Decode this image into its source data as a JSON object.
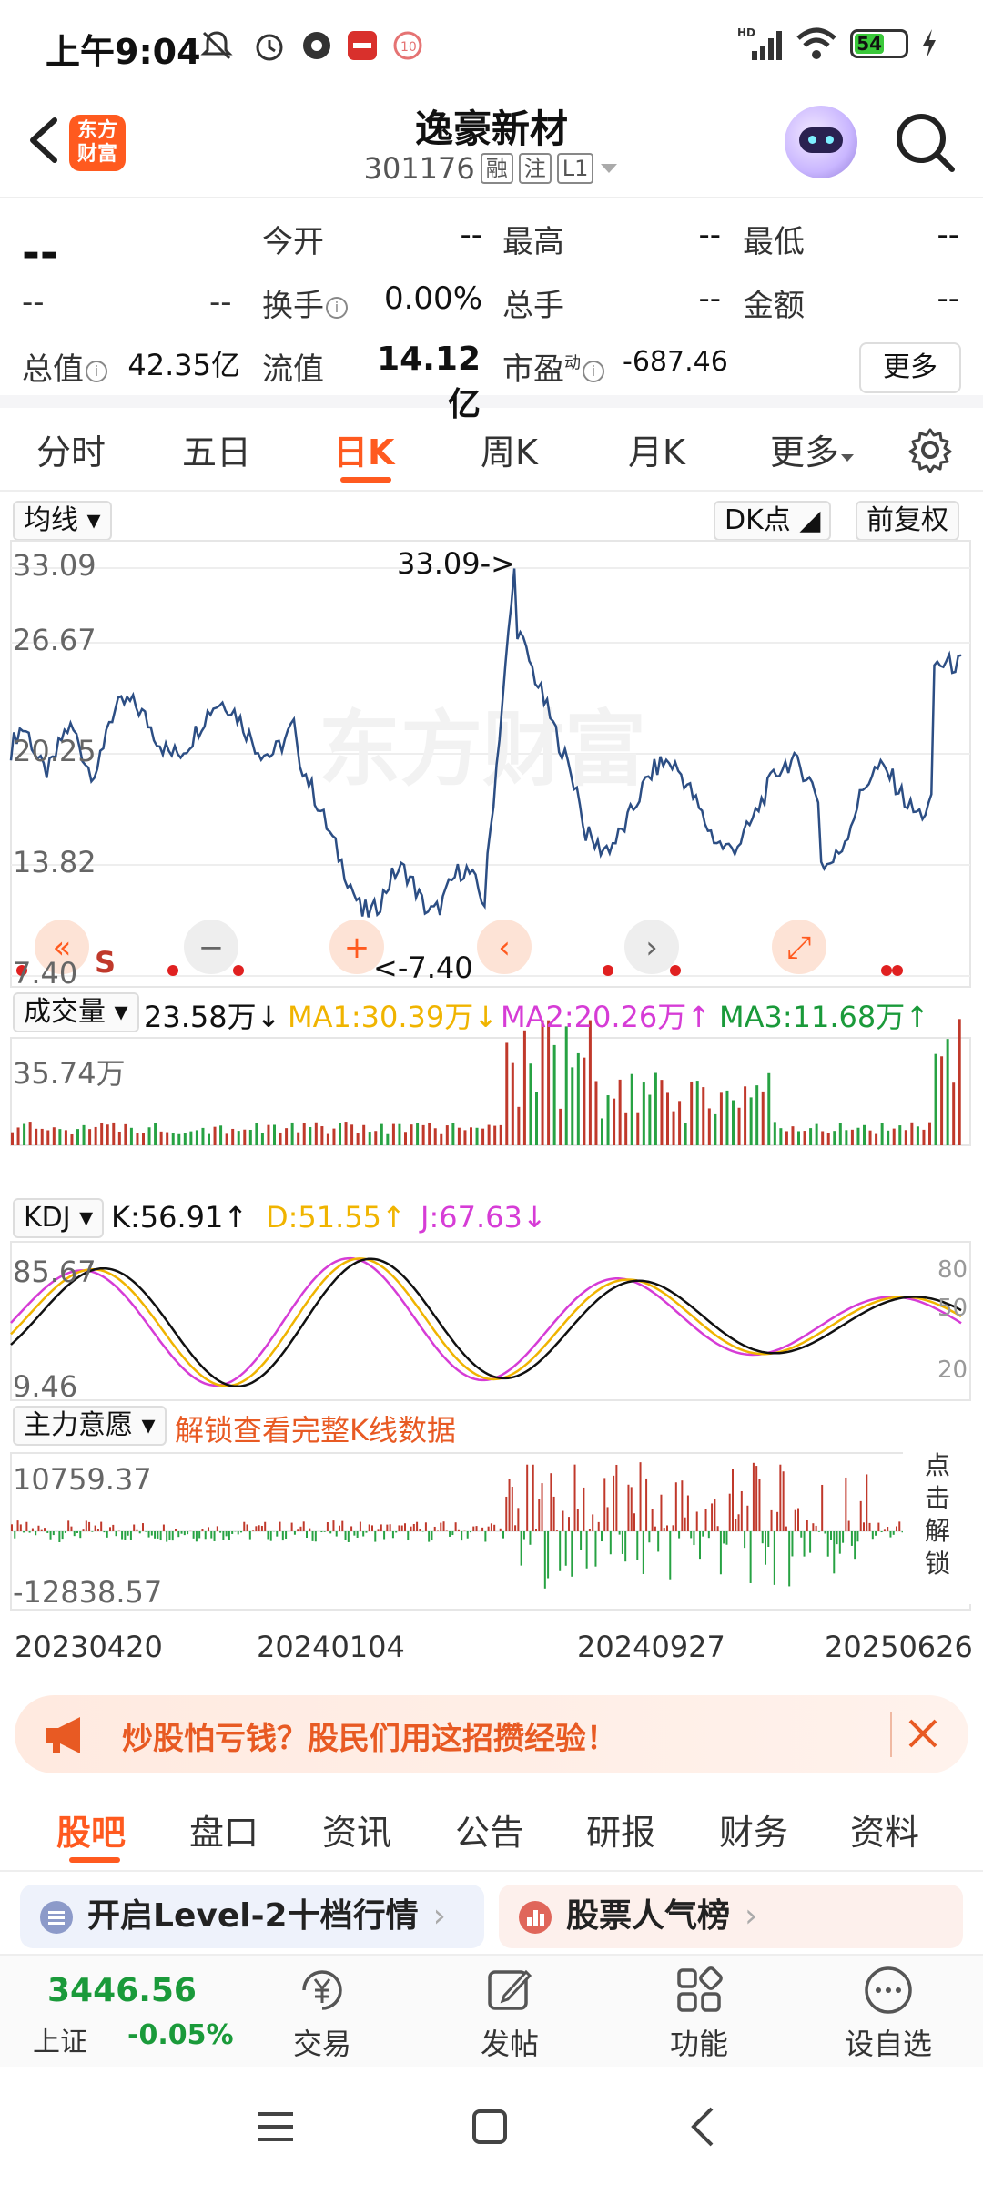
{
  "status_bar": {
    "time": "上午9:04",
    "battery": "54",
    "network": "HD"
  },
  "header": {
    "logo_text": "东方财富",
    "stock_name": "逸豪新材",
    "stock_code": "301176",
    "tags": [
      "融",
      "注",
      "L1"
    ]
  },
  "quote": {
    "price": "--",
    "change": "--",
    "change_pct": "--",
    "fields": [
      {
        "label": "今开",
        "value": "--"
      },
      {
        "label": "最高",
        "value": "--"
      },
      {
        "label": "最低",
        "value": "--"
      },
      {
        "label": "换手",
        "value": "0.00%"
      },
      {
        "label": "总手",
        "value": "--"
      },
      {
        "label": "金额",
        "value": "--"
      },
      {
        "label": "总值",
        "value": "42.35亿"
      },
      {
        "label": "流值",
        "value": "14.12亿"
      },
      {
        "label": "市盈",
        "value": "-687.46"
      }
    ],
    "pe_sup": "动",
    "more_label": "更多"
  },
  "period_tabs": [
    "分时",
    "五日",
    "日K",
    "周K",
    "月K",
    "更多"
  ],
  "active_period": "日K",
  "chart": {
    "ma_selector": "均线",
    "dk_selector": "DK点",
    "adjust_selector": "前复权",
    "price_axis": [
      "33.09",
      "26.67",
      "20.25",
      "13.82",
      "7.40"
    ],
    "max_annotation": "33.09->",
    "min_annotation": "<-7.40",
    "s_marker": "S",
    "volume": {
      "selector": "成交量",
      "current": "23.58万",
      "ma1": "MA1:30.39万",
      "ma2": "MA2:20.26万",
      "ma3": "MA3:11.68万",
      "axis_top": "35.74万"
    },
    "kdj": {
      "selector": "KDJ",
      "k": "K:56.91",
      "d": "D:51.55",
      "j": "J:67.63",
      "axis_top": "85.67",
      "axis_bottom": "9.46",
      "levels": [
        "80",
        "50",
        "20"
      ]
    },
    "main_force": {
      "selector": "主力意愿",
      "unlock_text": "解锁查看完整K线数据",
      "axis_top": "10759.37",
      "axis_bottom": "-12838.57",
      "side_tip": "点击解锁"
    },
    "dates": [
      "20230420",
      "20240104",
      "20240927",
      "20250626"
    ],
    "colors": {
      "price_line": "#2c4e84",
      "up": "#c0392b",
      "down": "#27a243",
      "ma1": "#f0b400",
      "ma2": "#d63cd6",
      "ma3": "#1a9a3a",
      "accent": "#ff5a1f"
    }
  },
  "banner": {
    "text": "炒股怕亏钱？股民们用这招攒经验！"
  },
  "community_tabs": [
    "股吧",
    "盘口",
    "资讯",
    "公告",
    "研报",
    "财务",
    "资料"
  ],
  "active_community_tab": "股吧",
  "cards": [
    {
      "label": "开启Level-2十档行情",
      "icon": "level2-icon"
    },
    {
      "label": "股票人气榜",
      "icon": "popularity-icon"
    }
  ],
  "bottom_bar": {
    "index_price": "3446.56",
    "index_name": "上证",
    "index_change": "-0.05%",
    "items": [
      "交易",
      "发帖",
      "功能",
      "设自选"
    ]
  }
}
